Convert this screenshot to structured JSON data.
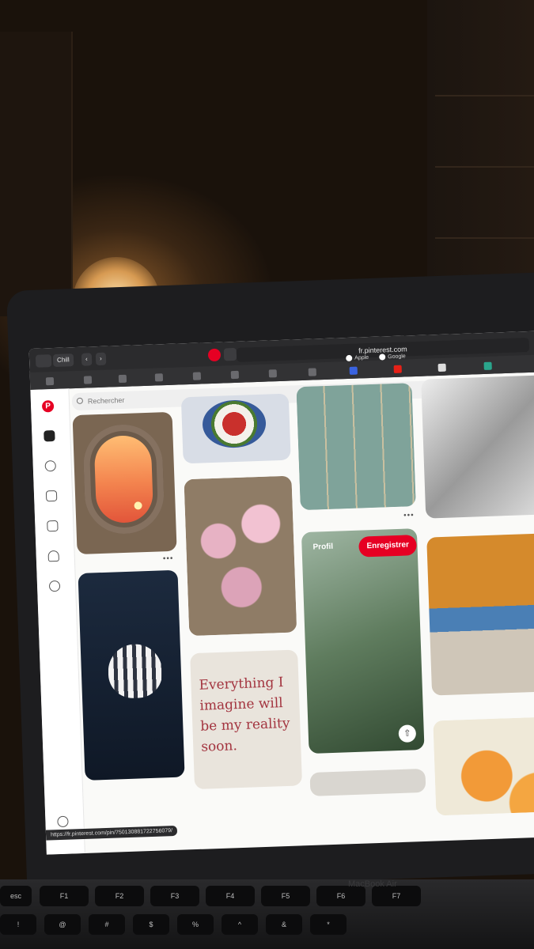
{
  "browser": {
    "profile_label": "Chill",
    "url": "fr.pinterest.com",
    "bookmarks": [
      {
        "label": "Apple"
      },
      {
        "label": "Google"
      }
    ],
    "status_url": "https://fr.pinterest.com/pin/750130881722756079/"
  },
  "pinterest": {
    "search_placeholder": "Rechercher",
    "logo_glyph": "P",
    "hover_pin": {
      "profile_label": "Profil",
      "save_label": "Enregistrer"
    },
    "note_pin_text": "Everything I imagine will be my reality soon.",
    "more_glyph": "•••",
    "share_glyph": "⇧"
  },
  "laptop": {
    "brand": "MacBook Air"
  },
  "keyboard": {
    "keys": [
      "esc",
      "F1",
      "F2",
      "F3",
      "F4",
      "F5",
      "F6",
      "F7"
    ],
    "number_keys": [
      "!",
      "@",
      "#",
      "$",
      "%",
      "^",
      "&",
      "*"
    ]
  }
}
